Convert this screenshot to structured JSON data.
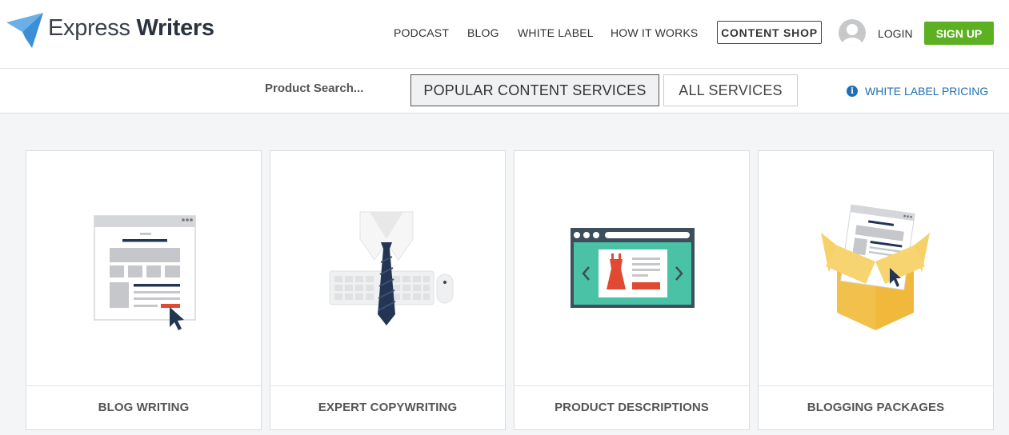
{
  "header": {
    "logo": {
      "text_light": "Express",
      "text_bold": "Writers",
      "icon": "paper-plane-icon"
    },
    "nav": [
      "PODCAST",
      "BLOG",
      "WHITE LABEL",
      "HOW IT WORKS"
    ],
    "content_shop": "CONTENT SHOP",
    "avatar_icon": "user-avatar-icon",
    "login": "LOGIN",
    "signup": "SIGN UP"
  },
  "toolbar": {
    "search_placeholder": "Product Search...",
    "tabs": [
      "POPULAR CONTENT SERVICES",
      "ALL SERVICES"
    ],
    "active_tab": "POPULAR CONTENT SERVICES",
    "pricing_link": "WHITE LABEL PRICING",
    "pricing_icon": "info-icon"
  },
  "products": [
    {
      "label": "BLOG WRITING",
      "icon": "blog-page-icon"
    },
    {
      "label": "EXPERT COPYWRITING",
      "icon": "tie-keyboard-icon"
    },
    {
      "label": "PRODUCT DESCRIPTIONS",
      "icon": "product-carousel-icon"
    },
    {
      "label": "BLOGGING PACKAGES",
      "icon": "package-box-icon"
    }
  ],
  "colors": {
    "accent_green": "#5cb021",
    "link_blue": "#1f6fb4",
    "navy": "#2b3a55"
  }
}
